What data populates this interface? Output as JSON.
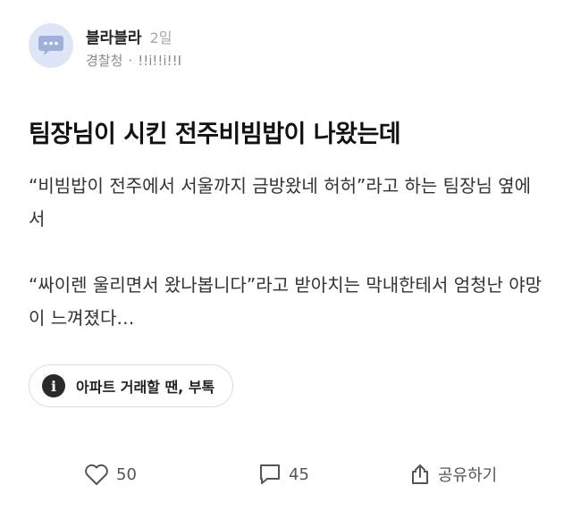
{
  "post": {
    "author": "블라블라",
    "time": "2일",
    "company": "경찰청",
    "separator": "·",
    "handle": "!!i!!i!!I",
    "title": "팀장님이 시킨 전주비빔밥이 나왔는데",
    "paragraphs": [
      "“비빔밥이 전주에서 서울까지 금방왔네 허허”라고 하는 팀장님 옆에서",
      "“싸이렌 울리면서 왔나봅니다”라고 받아치는 막내한테서 엄청난 야망이 느껴졌다…"
    ],
    "tag": {
      "icon": "info-icon",
      "label": "아파트 거래할 땐, 부톡"
    }
  },
  "actions": {
    "likes": "50",
    "comments": "45",
    "share_label": "공유하기"
  },
  "icons": {
    "avatar": "chat-bubble-icon",
    "like": "heart-icon",
    "comment": "comment-icon",
    "share": "share-icon"
  },
  "colors": {
    "avatar_bg": "#dde5f6",
    "avatar_icon": "#9fb0da",
    "meta_text": "#8a8a8a",
    "tag_icon_bg": "#2a2a2a"
  }
}
